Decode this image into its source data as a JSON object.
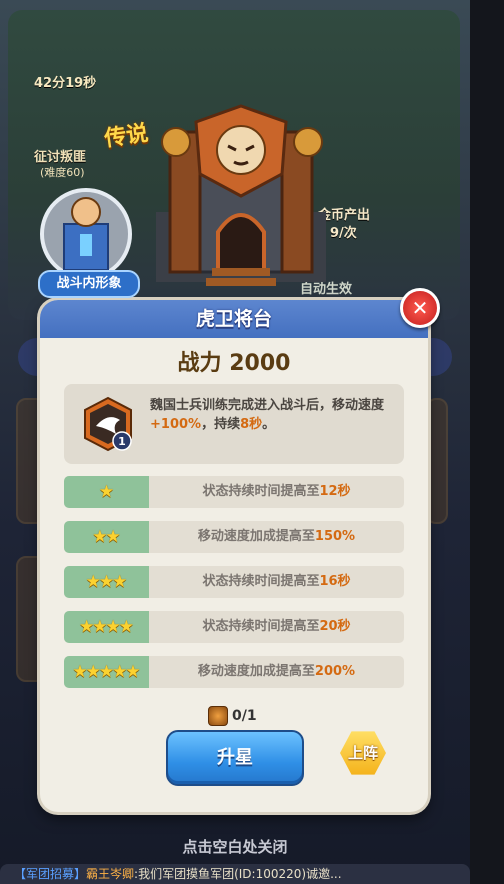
{
  "background": {
    "timer": "42分19秒",
    "task_title": "征讨叛匪",
    "task_sub": "(难度60)",
    "gold_label": "金币产出",
    "gold_value": "9/次",
    "effect_text": "自动生效"
  },
  "hero_preview": {
    "badge": "传说",
    "skin_label": "战斗内形象"
  },
  "modal": {
    "title": "虎卫将台",
    "power_label": "战力",
    "power_value": "2000",
    "description": {
      "part1": "魏国士兵训练完成进入战斗后，移动速度",
      "speed": "+100%",
      "part2": "，持续",
      "duration": "8秒",
      "part3": "。"
    },
    "skill_level": "1",
    "star_rows": [
      {
        "stars": 1,
        "text_prefix": "状态持续时间提高至",
        "value": "12秒"
      },
      {
        "stars": 2,
        "text_prefix": "移动速度加成提高至",
        "value": "150%"
      },
      {
        "stars": 3,
        "text_prefix": "状态持续时间提高至",
        "value": "16秒"
      },
      {
        "stars": 4,
        "text_prefix": "状态持续时间提高至",
        "value": "20秒"
      },
      {
        "stars": 5,
        "text_prefix": "移动速度加成提高至",
        "value": "200%"
      }
    ],
    "material_count": "0/1",
    "upgrade_button": "升星",
    "deploy_button": "上阵",
    "close_icon": "close-icon"
  },
  "footer": {
    "tap_to_close": "点击空白处关闭",
    "chat_tag": "【军团招募】",
    "chat_name": "霸王岑卿",
    "chat_text": ":我们军团摸鱼军团(ID:100220)诚邀..."
  }
}
